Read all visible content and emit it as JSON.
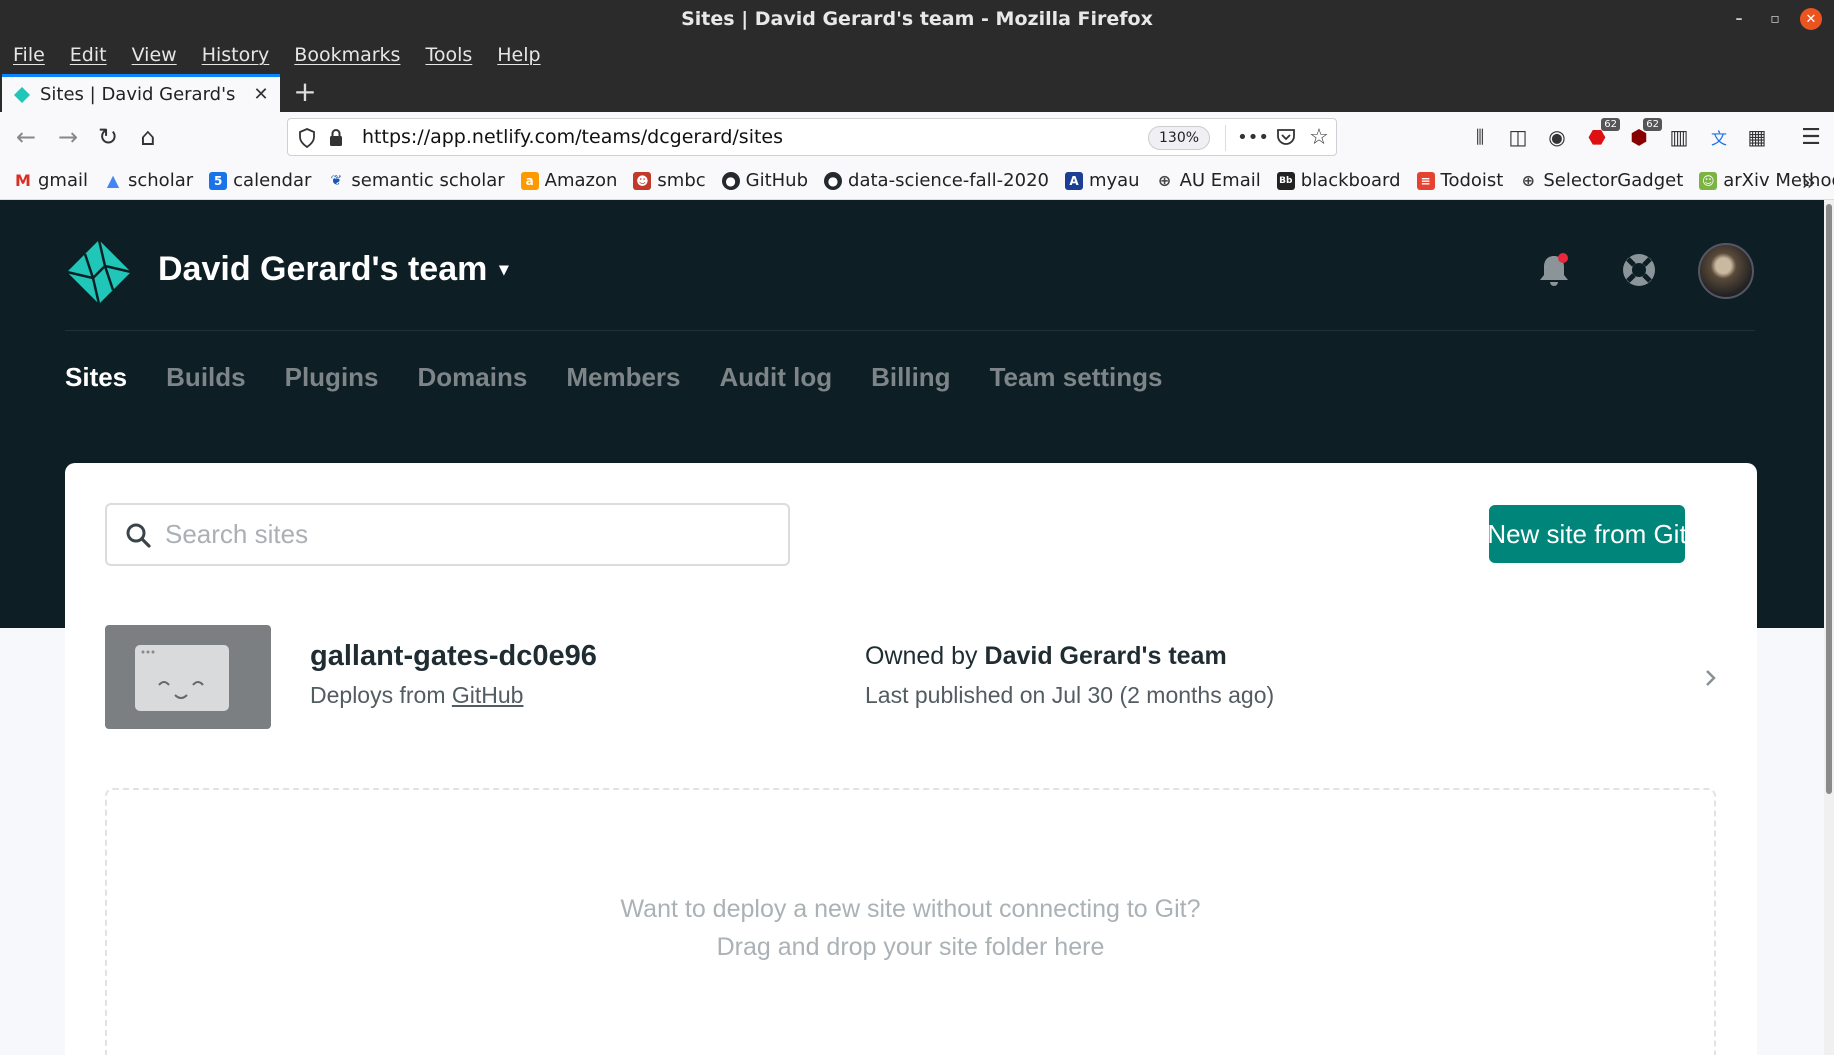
{
  "window": {
    "title": "Sites | David Gerard's team - Mozilla Firefox"
  },
  "menu": [
    "File",
    "Edit",
    "View",
    "History",
    "Bookmarks",
    "Tools",
    "Help"
  ],
  "tab": {
    "label": "Sites | David Gerard's team",
    "close": "✕"
  },
  "urlbar": {
    "url": "https://app.netlify.com/teams/dcgerard/sites",
    "zoom": "130%"
  },
  "toolbar": {
    "badge_count_1": "62",
    "badge_count_2": "62"
  },
  "bookmarks": [
    {
      "label": "gmail",
      "icon": "gmail-icon",
      "color": "#d93025"
    },
    {
      "label": "scholar",
      "icon": "scholar-icon",
      "color": "#4285f4"
    },
    {
      "label": "calendar",
      "icon": "calendar-icon",
      "color": "#1a73e8"
    },
    {
      "label": "semantic scholar",
      "icon": "semantic-scholar-icon",
      "color": "#1857b6"
    },
    {
      "label": "Amazon",
      "icon": "amazon-icon",
      "color": "#ff9900"
    },
    {
      "label": "smbc",
      "icon": "smbc-icon",
      "color": "#c0392b"
    },
    {
      "label": "GitHub",
      "icon": "github-icon",
      "color": "#24292e"
    },
    {
      "label": "data-science-fall-2020",
      "icon": "github-icon",
      "color": "#24292e"
    },
    {
      "label": "myau",
      "icon": "myau-icon",
      "color": "#1c3f94"
    },
    {
      "label": "AU Email",
      "icon": "globe-icon",
      "color": "#444444"
    },
    {
      "label": "blackboard",
      "icon": "blackboard-icon",
      "color": "#222222"
    },
    {
      "label": "Todoist",
      "icon": "todoist-icon",
      "color": "#e44332"
    },
    {
      "label": "SelectorGadget",
      "icon": "globe-icon",
      "color": "#444444"
    },
    {
      "label": "arXiv Methods",
      "icon": "arxiv-icon",
      "color": "#7cb342"
    }
  ],
  "header": {
    "team_name": "David Gerard's team"
  },
  "nav_tabs": [
    {
      "label": "Sites",
      "active": true
    },
    {
      "label": "Builds",
      "active": false
    },
    {
      "label": "Plugins",
      "active": false
    },
    {
      "label": "Domains",
      "active": false
    },
    {
      "label": "Members",
      "active": false
    },
    {
      "label": "Audit log",
      "active": false
    },
    {
      "label": "Billing",
      "active": false
    },
    {
      "label": "Team settings",
      "active": false
    }
  ],
  "search": {
    "placeholder": "Search sites"
  },
  "new_site_label": "New site from Git",
  "site": {
    "name": "gallant-gates-dc0e96",
    "deploys_prefix": "Deploys from ",
    "deploys_source": "GitHub",
    "owned_prefix": "Owned by ",
    "owner": "David Gerard's team",
    "last_published": "Last published on Jul 30 (2 months ago)"
  },
  "dropzone": {
    "line1": "Want to deploy a new site without connecting to Git?",
    "line2": "Drag and drop your site folder here"
  },
  "colors": {
    "header_bg": "#0e1e25",
    "accent": "#00857a",
    "notification_dot": "#e8283d"
  }
}
